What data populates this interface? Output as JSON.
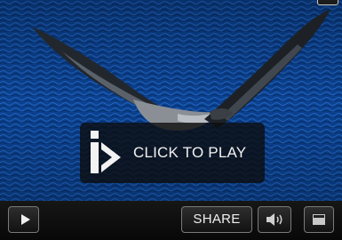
{
  "player": {
    "overlay": {
      "label": "CLICK TO PLAY",
      "icon": "brand-play-icon"
    },
    "controls": {
      "play_icon": "play-icon",
      "share_label": "SHARE",
      "volume_icon": "volume-icon",
      "fullscreen_icon": "fullscreen-icon"
    }
  },
  "colors": {
    "water": "#0a3f8c",
    "overlay_bg": "#0c0c0c",
    "control_bar": "#101010",
    "button_border": "#7a7a7a",
    "text": "#f0f0f0"
  }
}
